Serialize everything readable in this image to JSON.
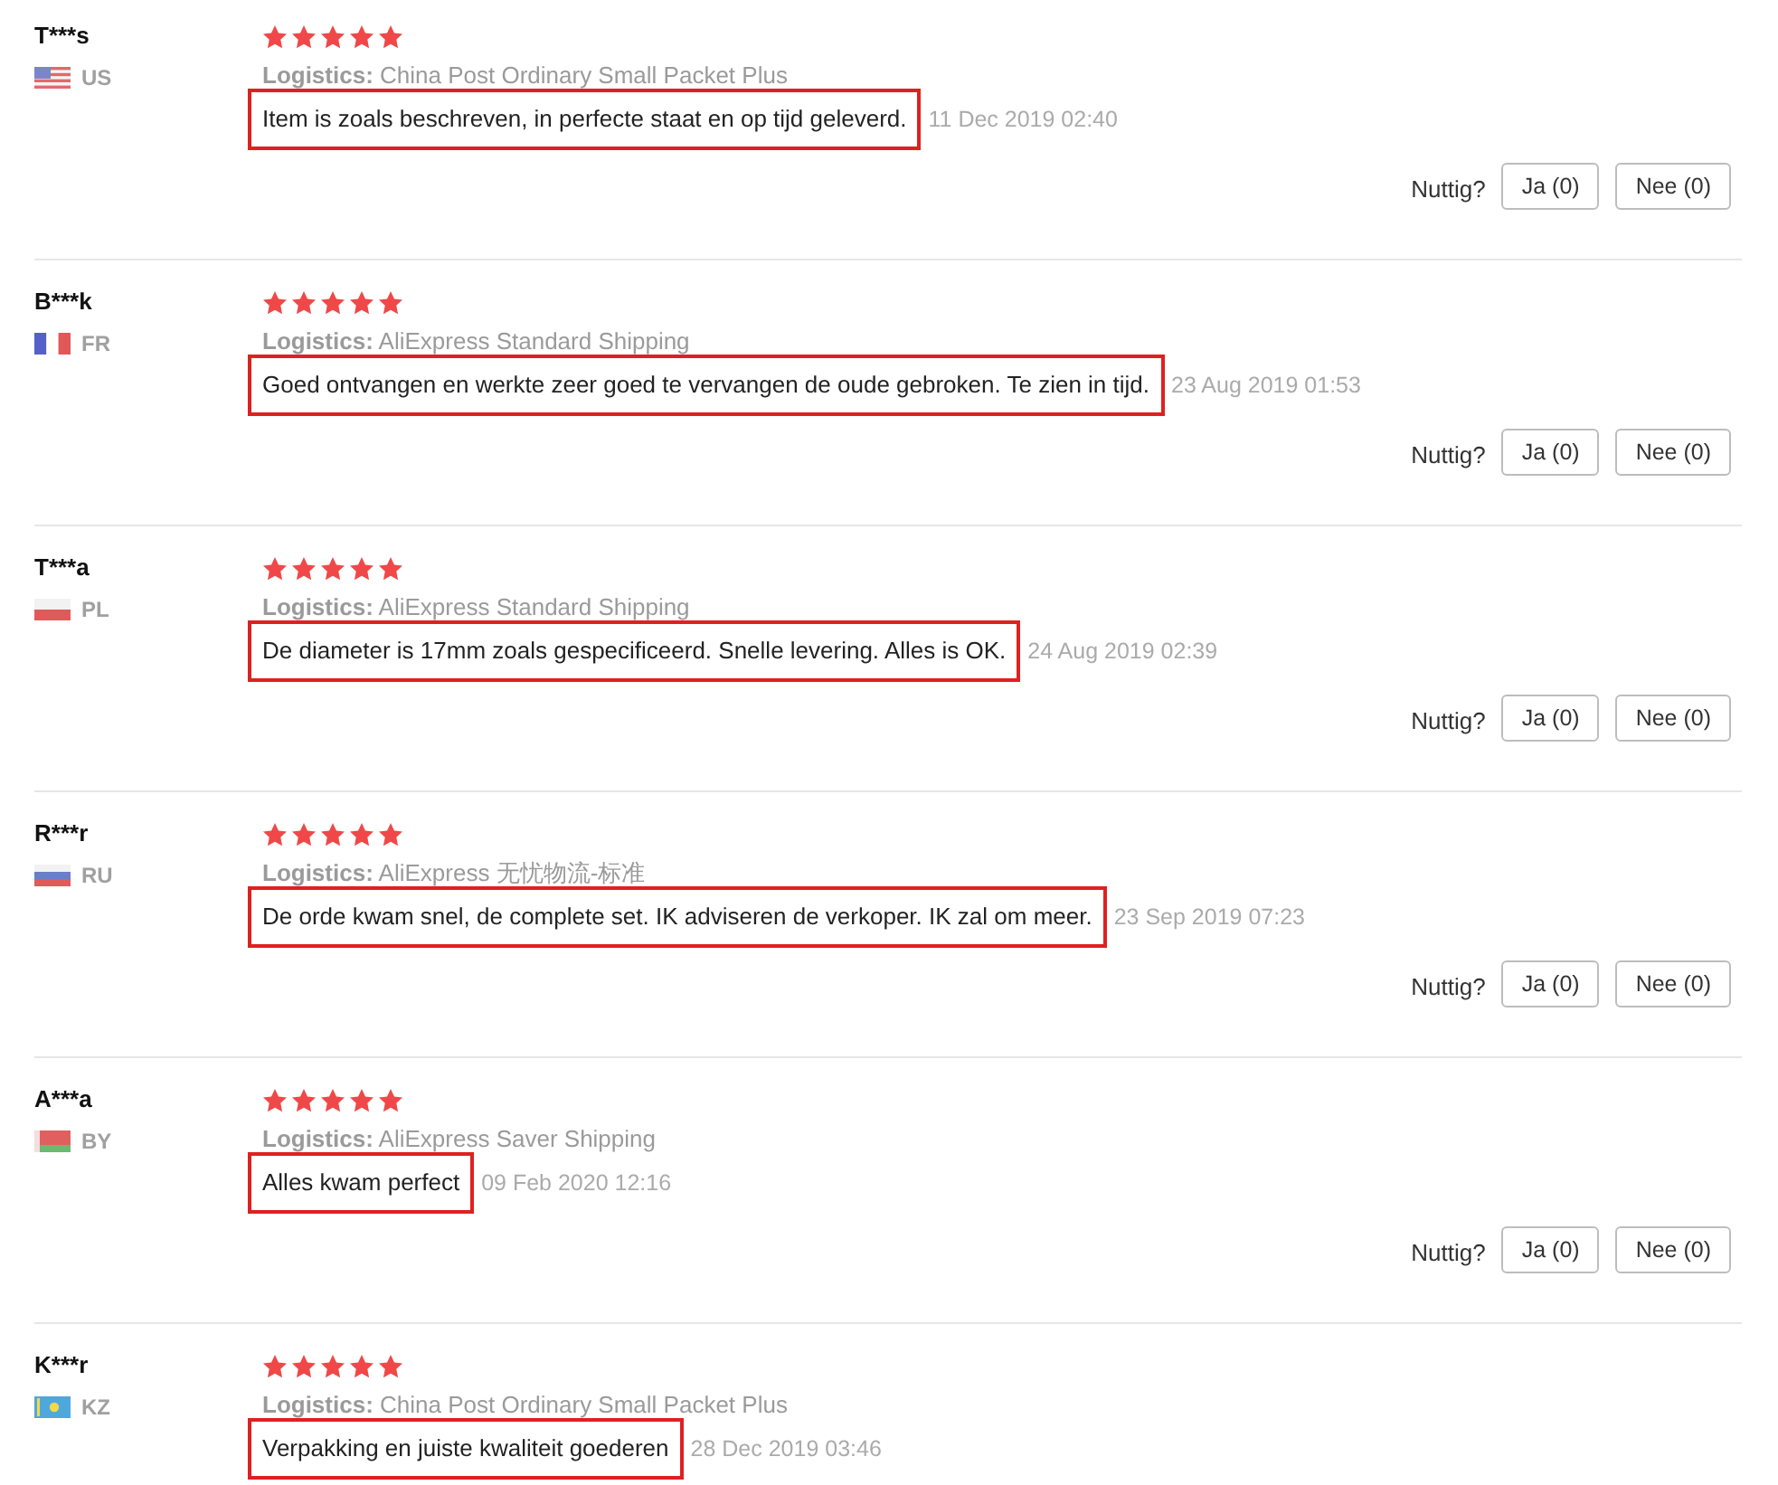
{
  "reviews": [
    {
      "name": "T***s",
      "country": "US",
      "flag": {
        "kind": "us"
      },
      "stars": 5,
      "logistics": "**Logistics:** China Post Ordinary Small Packet Plus",
      "text": "Item is zoals beschreven, in perfecte staat en op tijd geleverd.",
      "highlighted": true,
      "date": "11 Dec 2019 02:40",
      "helpful": {
        "label": "Nuttig?",
        "yes": "Ja (0)",
        "no": "Nee (0)"
      }
    },
    {
      "name": "B***k",
      "country": "FR",
      "flag": {
        "kind": "fr"
      },
      "stars": 5,
      "logistics": "**Logistics:** AliExpress Standard Shipping",
      "text": "Goed ontvangen en werkte zeer goed te vervangen de oude gebroken. Te zien in tijd.",
      "highlighted": true,
      "date": "23 Aug 2019 01:53",
      "helpful": {
        "label": "Nuttig?",
        "yes": "Ja (0)",
        "no": "Nee (0)"
      }
    },
    {
      "name": "T***a",
      "country": "PL",
      "flag": {
        "kind": "pl"
      },
      "stars": 5,
      "logistics": "**Logistics:** AliExpress Standard Shipping",
      "text": "De diameter is 17mm zoals gespecificeerd. Snelle levering. Alles is OK.",
      "highlighted": true,
      "date": "24 Aug 2019 02:39",
      "helpful": {
        "label": "Nuttig?",
        "yes": "Ja (0)",
        "no": "Nee (0)"
      }
    },
    {
      "name": "R***r",
      "country": "RU",
      "flag": {
        "kind": "ru"
      },
      "stars": 5,
      "logistics": "**Logistics:** AliExpress 无忧物流-标准",
      "text": "De orde kwam snel, de complete set. IK adviseren de verkoper. IK zal om meer.",
      "highlighted": true,
      "date": "23 Sep 2019 07:23",
      "helpful": {
        "label": "Nuttig?",
        "yes": "Ja (0)",
        "no": "Nee (0)"
      }
    },
    {
      "name": "A***a",
      "country": "BY",
      "flag": {
        "kind": "by"
      },
      "stars": 5,
      "logistics": "**Logistics:** AliExpress Saver Shipping",
      "text": "Alles kwam perfect",
      "highlighted": true,
      "date": "09 Feb 2020 12:16",
      "helpful": {
        "label": "Nuttig?",
        "yes": "Ja (0)",
        "no": "Nee (0)"
      }
    },
    {
      "name": "K***r",
      "country": "KZ",
      "flag": {
        "kind": "kz"
      },
      "stars": 5,
      "logistics": "**Logistics:** China Post Ordinary Small Packet Plus",
      "text": "Verpakking en juiste kwaliteit goederen",
      "highlighted": true,
      "date": "28 Dec 2019 03:46"
    }
  ]
}
